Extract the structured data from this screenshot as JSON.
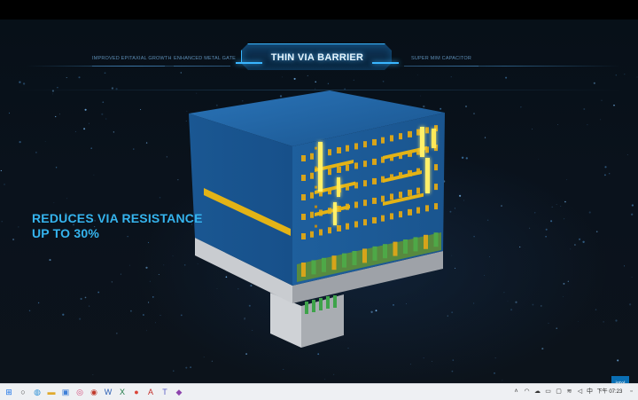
{
  "nav": {
    "items": [
      {
        "label": "IMPROVED EPITAXIAL GROWTH",
        "active": false
      },
      {
        "label": "ENHANCED METAL GATE",
        "active": false
      },
      {
        "label": "THIN VIA BARRIER",
        "active": true
      },
      {
        "label": "SUPER MIM CAPACITOR",
        "active": false
      }
    ]
  },
  "headline": {
    "line1": "REDUCES VIA RESISTANCE",
    "line2": "UP TO 30%"
  },
  "logo": {
    "text": "intel"
  },
  "taskbar": {
    "pinned_icons": [
      "windows-start-icon",
      "search-icon",
      "edge-icon",
      "file-explorer-icon",
      "photos-icon",
      "media-player-icon",
      "word-icon",
      "excel-icon",
      "chrome-icon",
      "acrobat-icon",
      "teams-icon",
      "app-icon"
    ],
    "clock": "下午 07:23"
  },
  "colors": {
    "accent": "#39b6ff",
    "headline": "#35b4ee",
    "cube_blue": "#1c5fa3",
    "trace_yellow": "#f0c020"
  }
}
